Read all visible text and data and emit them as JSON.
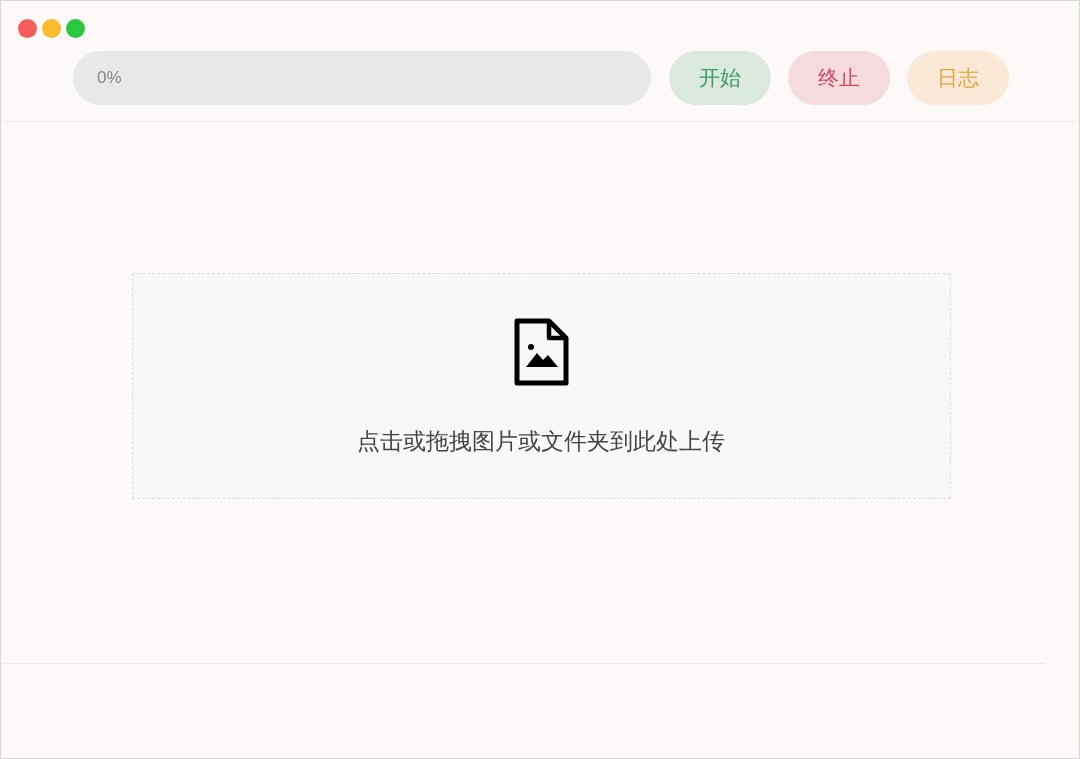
{
  "progress": {
    "label": "0%",
    "level": 0
  },
  "buttons": [
    {
      "label": "开始",
      "color": "#3d9a63"
    },
    {
      "label": "终止",
      "color": "#d04a66"
    },
    {
      "label": "日志",
      "color": "#e8a23c"
    }
  ],
  "upload": {
    "hint": "点击或拖拽图片或文件夹到此处上传"
  }
}
